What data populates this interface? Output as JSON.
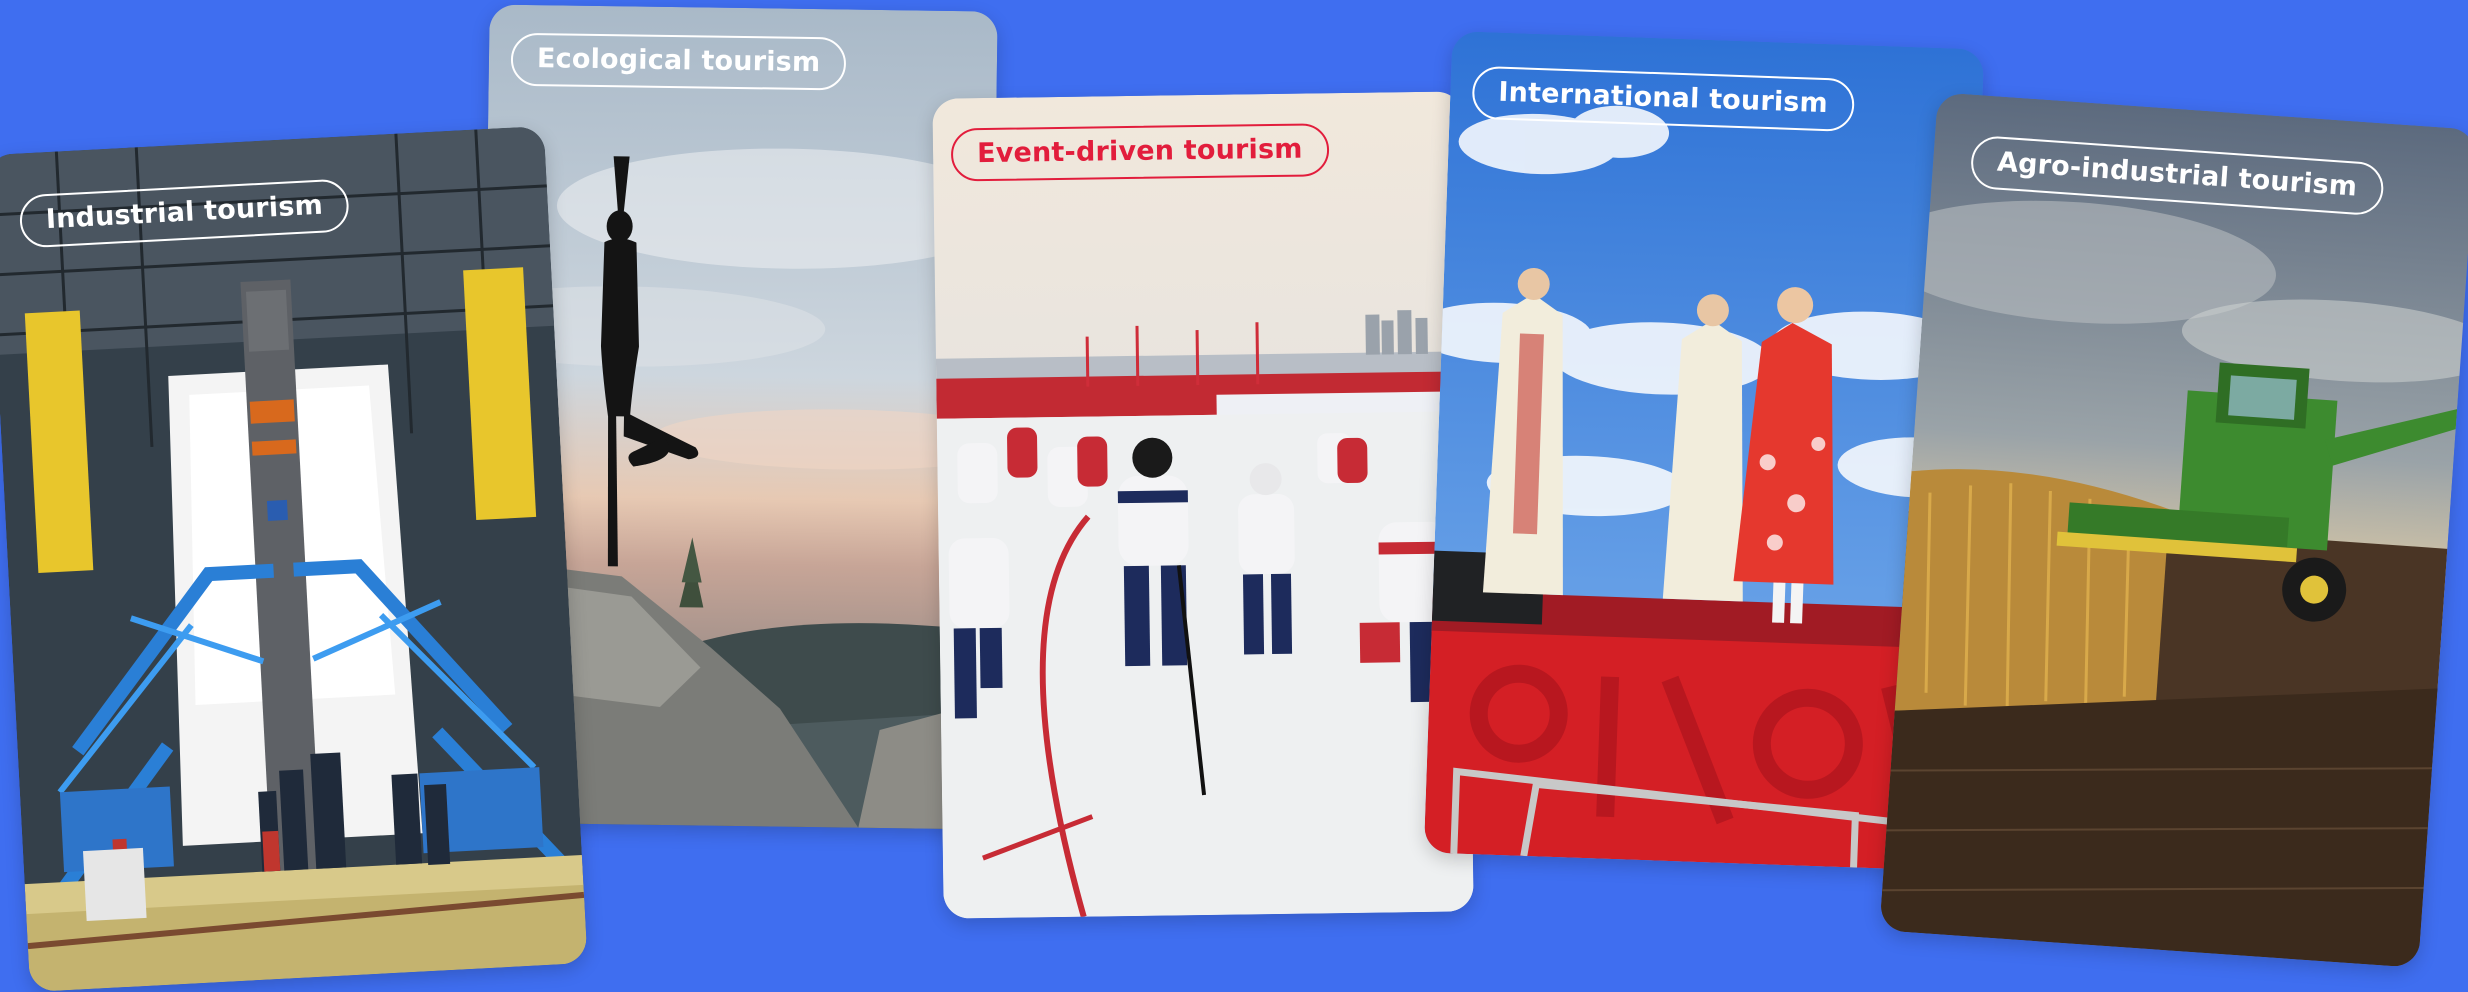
{
  "cards": [
    {
      "label": "Industrial tourism"
    },
    {
      "label": "Ecological tourism"
    },
    {
      "label": "Event-driven tourism"
    },
    {
      "label": "International tourism"
    },
    {
      "label": "Agro-industrial tourism"
    }
  ],
  "colors": {
    "background": "#3f6ef0",
    "label_outline": "#ffffff",
    "event_label": "#e21d3c"
  }
}
